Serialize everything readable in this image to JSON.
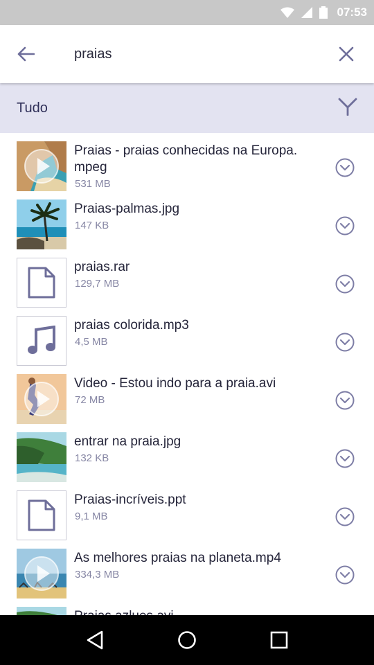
{
  "status_bar": {
    "time": "07:53",
    "icons": [
      "wifi-icon",
      "signal-icon",
      "battery-icon"
    ]
  },
  "search": {
    "query": "praias",
    "accent": "#6e6e9a"
  },
  "filter": {
    "label": "Tudo"
  },
  "files": [
    {
      "name": "Praias - praias conhecidas na Europa.\nmpeg",
      "size": "531 MB",
      "thumb": "video-beach-rocks",
      "kind": "video"
    },
    {
      "name": "Praias-palmas.jpg",
      "size": "147 KB",
      "thumb": "palm-tree",
      "kind": "image"
    },
    {
      "name": "praias.rar",
      "size": "129,7 MB",
      "thumb": "document-icon",
      "kind": "file"
    },
    {
      "name": "praias colorida.mp3",
      "size": "4,5 MB",
      "thumb": "music-note-icon",
      "kind": "audio"
    },
    {
      "name": "Video - Estou indo para a praia.avi",
      "size": "72 MB",
      "thumb": "video-runner",
      "kind": "video"
    },
    {
      "name": "entrar na praia.jpg",
      "size": "132 KB",
      "thumb": "coast-cliffs",
      "kind": "image"
    },
    {
      "name": "Praias-incríveis.ppt",
      "size": "9,1 MB",
      "thumb": "document-icon",
      "kind": "file"
    },
    {
      "name": "As melhores praias na planeta.mp4",
      "size": "334,3 MB",
      "thumb": "video-beach-crowd",
      "kind": "video"
    },
    {
      "name": "Praias azlues.avi",
      "size": "",
      "thumb": "coast-cliffs",
      "kind": "video"
    }
  ],
  "nav": [
    "back-triangle-icon",
    "home-circle-icon",
    "recents-square-icon"
  ]
}
